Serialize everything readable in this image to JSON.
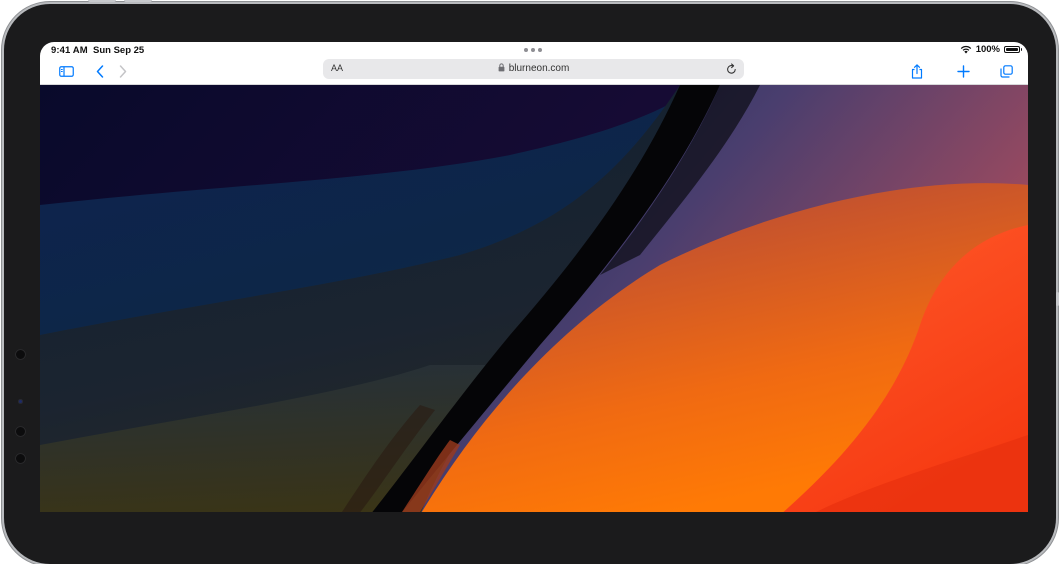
{
  "status_bar": {
    "time": "9:41 AM",
    "date": "Sun Sep 25",
    "battery_text": "100%",
    "battery_level": 1.0,
    "icons": [
      "multitask-dots-icon",
      "wifi-icon",
      "battery-icon"
    ]
  },
  "toolbar": {
    "reader_label": "AA",
    "url": "blurneon.com",
    "icons": [
      "sidebar-icon",
      "back-icon",
      "forward-icon",
      "lock-icon",
      "reload-icon",
      "share-icon",
      "new-tab-icon",
      "tabs-icon"
    ]
  },
  "colors": {
    "accent": "#007aff",
    "frame": "#1b1b1c",
    "address_bar": "#e8e8ea"
  }
}
